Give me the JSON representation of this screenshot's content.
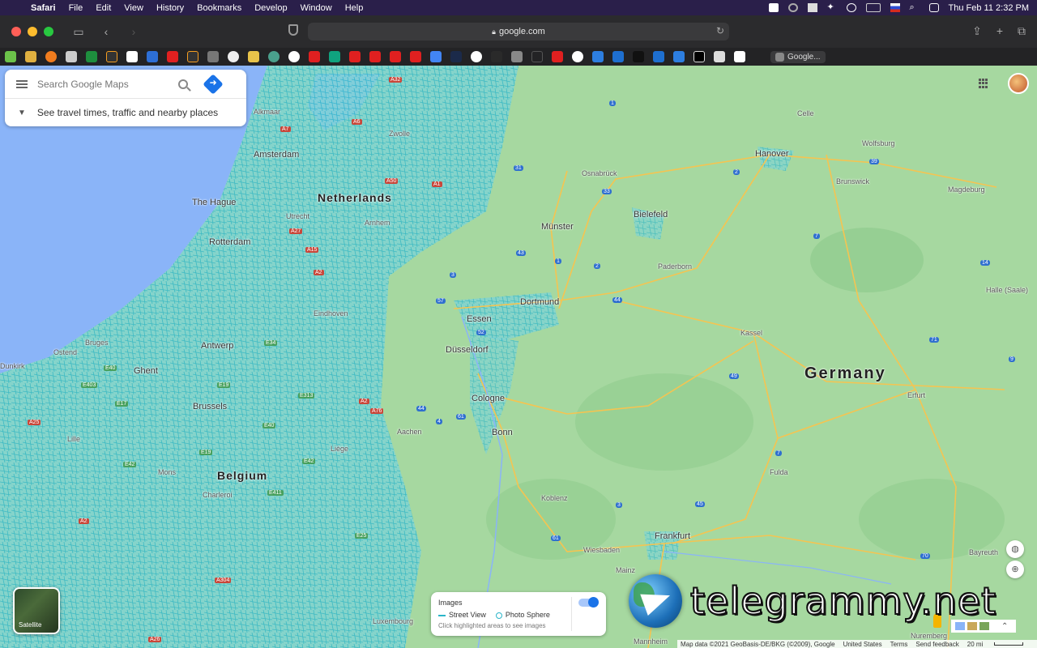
{
  "menubar": {
    "app": "Safari",
    "items": [
      "File",
      "Edit",
      "View",
      "History",
      "Bookmarks",
      "Develop",
      "Window",
      "Help"
    ],
    "clock": "Thu Feb 11  2:32 PM"
  },
  "toolbar": {
    "url": "google.com"
  },
  "tab": {
    "label": "Google..."
  },
  "search": {
    "placeholder": "Search Google Maps",
    "travel_hint": "See travel times, traffic and nearby places"
  },
  "map_labels": {
    "countries": [
      "Netherlands",
      "Belgium",
      "Germany"
    ],
    "cities": [
      "Amsterdam",
      "The Hague",
      "Rotterdam",
      "Utrecht",
      "Arnhem",
      "Zwolle",
      "Alkmaar",
      "Eindhoven",
      "Antwerp",
      "Ghent",
      "Bruges",
      "Ostend",
      "Brussels",
      "Lille",
      "Mons",
      "Charleroi",
      "Liège",
      "Luxembourg",
      "Aachen",
      "Cologne",
      "Bonn",
      "Düsseldorf",
      "Essen",
      "Dortmund",
      "Münster",
      "Osnabrück",
      "Bielefeld",
      "Paderborn",
      "Hanover",
      "Celle",
      "Wolfsburg",
      "Brunswick",
      "Magdeburg",
      "Kassel",
      "Halle (Saale)",
      "Erfurt",
      "Fulda",
      "Koblenz",
      "Wiesbaden",
      "Mainz",
      "Frankfurt",
      "Mannheim",
      "Bayreuth",
      "Nuremberg",
      "Dunkirk"
    ]
  },
  "satellite": {
    "label": "Satellite"
  },
  "images_panel": {
    "title": "Images",
    "street_view": "Street View",
    "photo_sphere": "Photo Sphere",
    "hint": "Click highlighted areas to see images"
  },
  "watermark": {
    "text": "telegrammy.net"
  },
  "footer": {
    "attribution": "Map data ©2021 GeoBasis-DE/BKG (©2009), Google",
    "region": "United States",
    "terms": "Terms",
    "feedback": "Send feedback",
    "scale": "20 mi"
  },
  "colors": {
    "map_land": "#a6d8a0",
    "water": "#8ab4f8",
    "street_view_overlay": "#2bb5c9",
    "accent": "#1a73e8"
  }
}
